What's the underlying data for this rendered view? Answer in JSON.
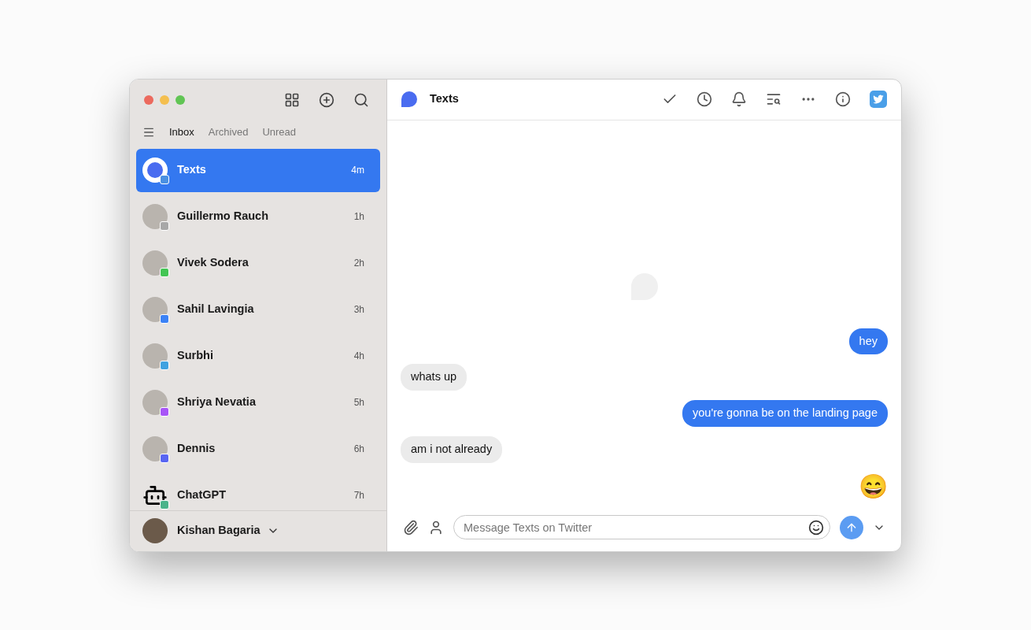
{
  "sidebar": {
    "tabs": [
      {
        "label": "Inbox",
        "selected": true
      },
      {
        "label": "Archived",
        "selected": false
      },
      {
        "label": "Unread",
        "selected": false
      }
    ],
    "conversations": [
      {
        "name": "Texts",
        "time": "4m",
        "selected": true,
        "color": "#4a90e2",
        "kind": "logo"
      },
      {
        "name": "Guillermo Rauch",
        "time": "1h",
        "selected": false,
        "color": "#a8a8a8",
        "kind": "person"
      },
      {
        "name": "Vivek Sodera",
        "time": "2h",
        "selected": false,
        "color": "#43c553",
        "kind": "person"
      },
      {
        "name": "Sahil Lavingia",
        "time": "3h",
        "selected": false,
        "color": "#3b82f6",
        "kind": "person"
      },
      {
        "name": "Surbhi",
        "time": "4h",
        "selected": false,
        "color": "#3fa2e0",
        "kind": "person"
      },
      {
        "name": "Shriya Nevatia",
        "time": "5h",
        "selected": false,
        "color": "#a855f7",
        "kind": "person"
      },
      {
        "name": "Dennis",
        "time": "6h",
        "selected": false,
        "color": "#5865f2",
        "kind": "person"
      },
      {
        "name": "ChatGPT",
        "time": "7h",
        "selected": false,
        "color": "#4ab38a",
        "kind": "bot"
      }
    ],
    "account": {
      "name": "Kishan Bagaria"
    }
  },
  "chat": {
    "title": "Texts",
    "messages": [
      {
        "kind": "outgoing",
        "text": "hey"
      },
      {
        "kind": "incoming",
        "text": "whats up"
      },
      {
        "kind": "outgoing",
        "text": "you're gonna be on the landing page"
      },
      {
        "kind": "incoming",
        "text": "am i not already"
      },
      {
        "kind": "emoji",
        "text": "😄"
      }
    ],
    "composer": {
      "placeholder": "Message Texts on Twitter"
    }
  }
}
